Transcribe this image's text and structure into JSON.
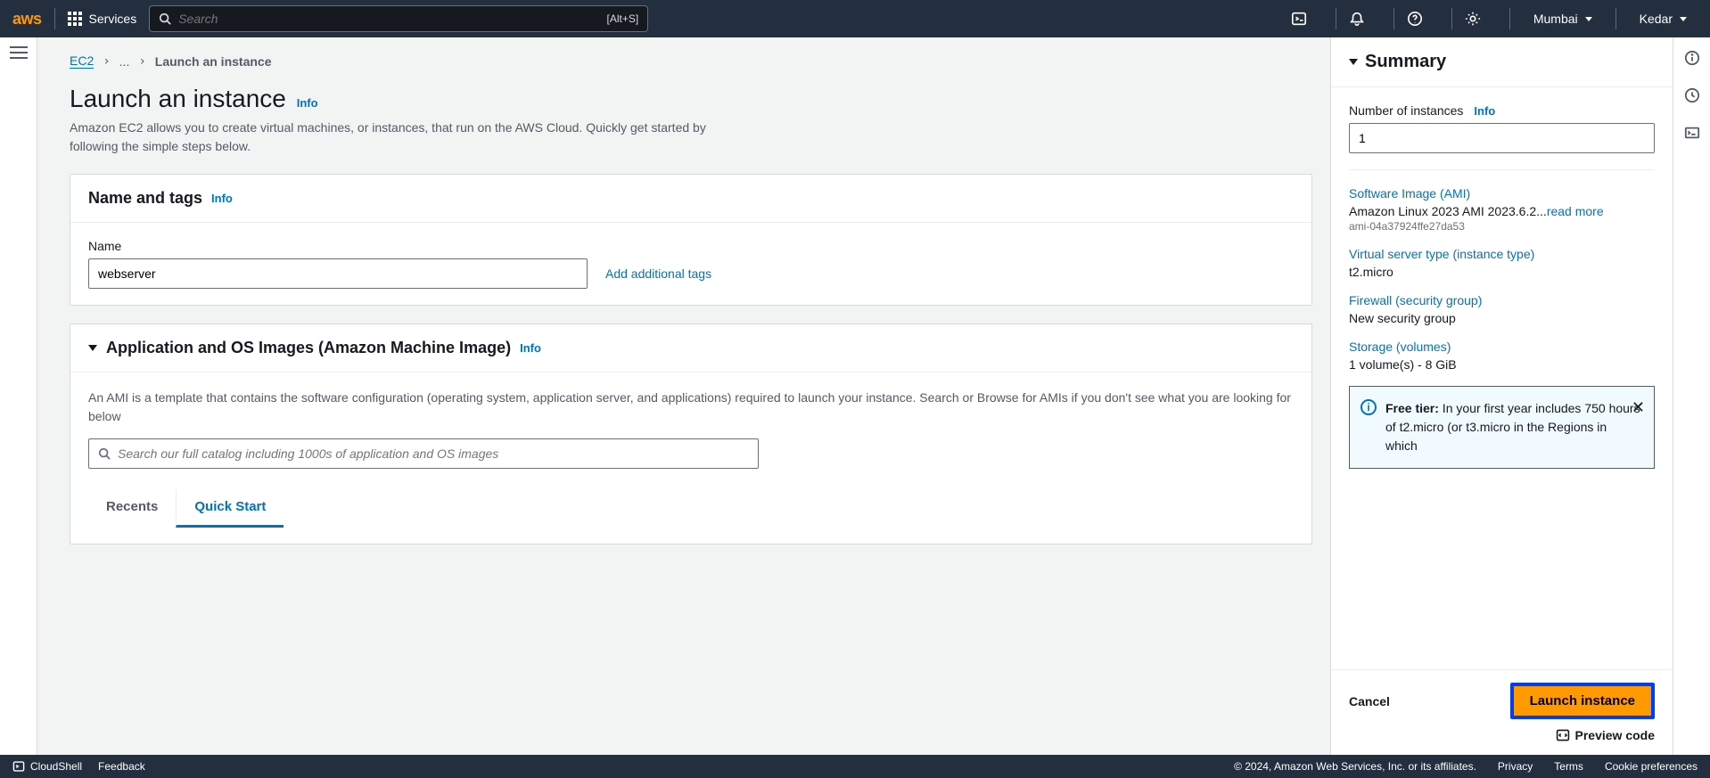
{
  "topbar": {
    "logo": "aws",
    "services": "Services",
    "search_placeholder": "Search",
    "search_kbd": "[Alt+S]",
    "region": "Mumbai",
    "user": "Kedar"
  },
  "breadcrumb": {
    "root": "EC2",
    "ellipsis": "...",
    "current": "Launch an instance"
  },
  "page": {
    "title": "Launch an instance",
    "info": "Info",
    "desc": "Amazon EC2 allows you to create virtual machines, or instances, that run on the AWS Cloud. Quickly get started by following the simple steps below."
  },
  "name_tags": {
    "header": "Name and tags",
    "info": "Info",
    "label": "Name",
    "value": "webserver",
    "add_link": "Add additional tags"
  },
  "ami": {
    "header": "Application and OS Images (Amazon Machine Image)",
    "info": "Info",
    "desc": "An AMI is a template that contains the software configuration (operating system, application server, and applications) required to launch your instance. Search or Browse for AMIs if you don't see what you are looking for below",
    "search_placeholder": "Search our full catalog including 1000s of application and OS images",
    "tab_recents": "Recents",
    "tab_quickstart": "Quick Start"
  },
  "summary": {
    "header": "Summary",
    "num_label": "Number of instances",
    "info": "Info",
    "num_value": "1",
    "ami_link": "Software Image (AMI)",
    "ami_name": "Amazon Linux 2023 AMI 2023.6.2...",
    "read_more": "read more",
    "ami_id": "ami-04a37924ffe27da53",
    "type_link": "Virtual server type (instance type)",
    "type_val": "t2.micro",
    "sg_link": "Firewall (security group)",
    "sg_val": "New security group",
    "storage_link": "Storage (volumes)",
    "storage_val": "1 volume(s) - 8 GiB",
    "free_tier_strong": "Free tier:",
    "free_tier_text": " In your first year includes 750 hours of t2.micro (or t3.micro in the Regions in which",
    "cancel": "Cancel",
    "launch": "Launch instance",
    "preview": "Preview code"
  },
  "bottombar": {
    "cloudshell": "CloudShell",
    "feedback": "Feedback",
    "copyright": "© 2024, Amazon Web Services, Inc. or its affiliates.",
    "privacy": "Privacy",
    "terms": "Terms",
    "cookie": "Cookie preferences"
  }
}
